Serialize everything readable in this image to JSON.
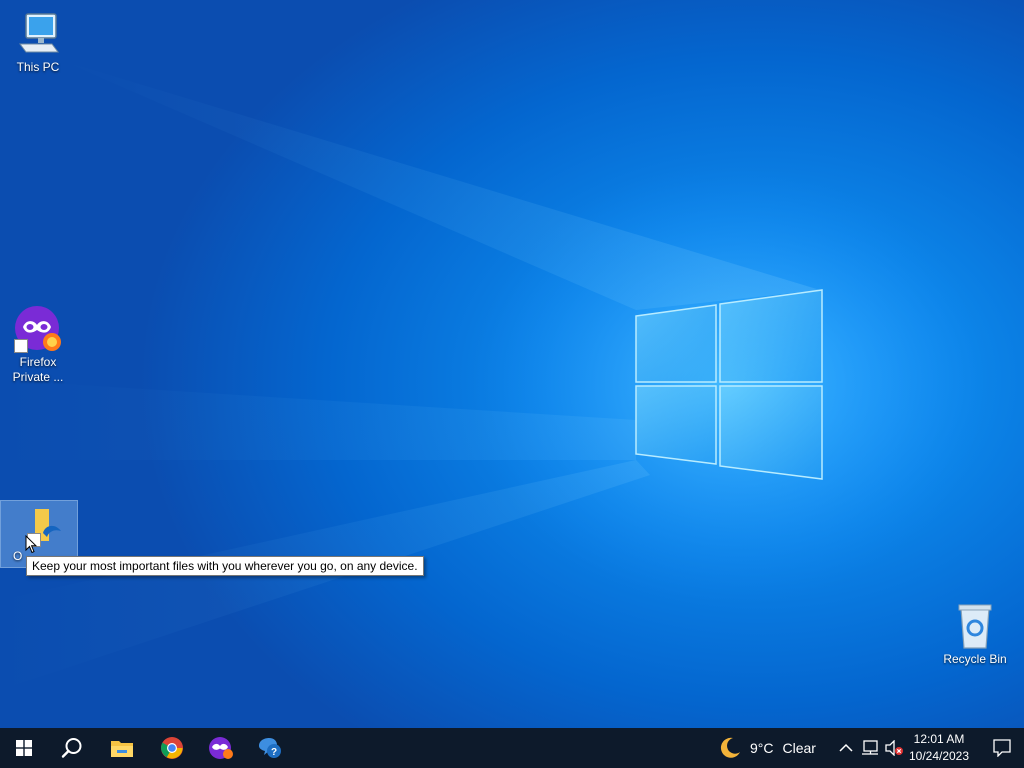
{
  "desktop": {
    "icons": [
      {
        "label": "This PC",
        "icon": "computer-icon"
      },
      {
        "label": "Firefox Private ...",
        "label_line1": "Firefox",
        "label_line2": "Private ...",
        "icon": "firefox-private-icon"
      },
      {
        "label": "O",
        "icon": "onedrive-folder-icon"
      },
      {
        "label": "Recycle Bin",
        "icon": "recycle-bin-icon"
      }
    ],
    "tooltip": "Keep your most important files with you wherever you go, on any device."
  },
  "taskbar": {
    "pinned": [
      {
        "name": "Start",
        "icon": "windows-start-icon"
      },
      {
        "name": "Search",
        "icon": "search-icon"
      },
      {
        "name": "File Explorer",
        "icon": "file-explorer-icon"
      },
      {
        "name": "Google Chrome",
        "icon": "chrome-icon"
      },
      {
        "name": "Firefox Private Browsing",
        "icon": "firefox-private-icon"
      },
      {
        "name": "Get Help",
        "icon": "get-help-icon"
      }
    ],
    "weather": {
      "temp": "9°C",
      "condition": "Clear",
      "icon": "moon-icon"
    },
    "tray": [
      {
        "name": "Show hidden icons",
        "icon": "chevron-up-icon"
      },
      {
        "name": "Network",
        "icon": "network-icon"
      },
      {
        "name": "Volume",
        "icon": "volume-muted-icon"
      }
    ],
    "clock": {
      "time": "12:01 AM",
      "date": "10/24/2023"
    },
    "notifications": {
      "icon": "notification-icon"
    }
  },
  "colors": {
    "desktop_blue": "#0a78dc",
    "taskbar": "#0d1a2b"
  }
}
